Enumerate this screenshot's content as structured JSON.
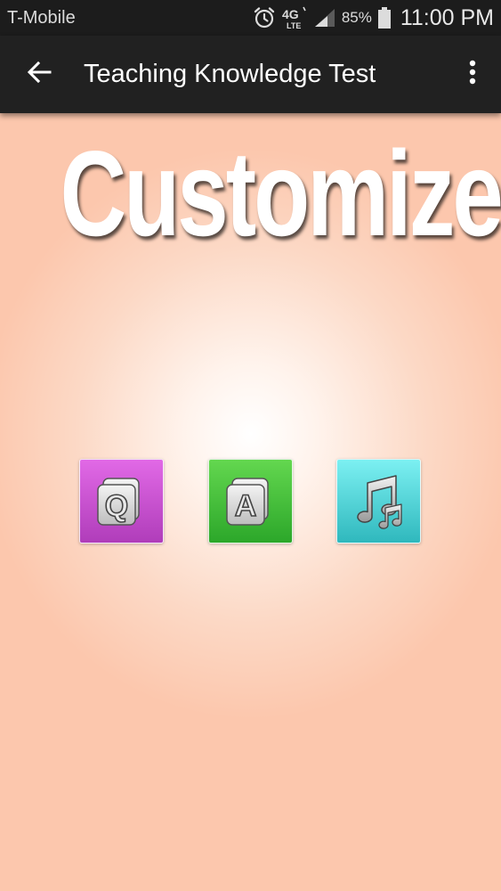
{
  "status_bar": {
    "carrier": "T-Mobile",
    "network": "4G LTE",
    "battery": "85%",
    "time": "11:00 PM",
    "icons": [
      "alarm-icon",
      "network-4g-lte-icon",
      "signal-icon",
      "battery-icon"
    ]
  },
  "app_bar": {
    "back_icon": "arrow-left-icon",
    "title": "Teaching Knowledge Test",
    "menu_icon": "more-vert-icon"
  },
  "main": {
    "heading": "Customize",
    "tiles": [
      {
        "name": "question",
        "letter": "Q",
        "color": "#c24fcc"
      },
      {
        "name": "answer",
        "letter": "A",
        "color": "#3fbd37"
      },
      {
        "name": "music",
        "icon": "music-note-icon",
        "color": "#49d0d4"
      }
    ]
  },
  "colors": {
    "background": "#fcc7ad",
    "app_bar": "#212121",
    "status_bar": "#1c1c1c"
  }
}
